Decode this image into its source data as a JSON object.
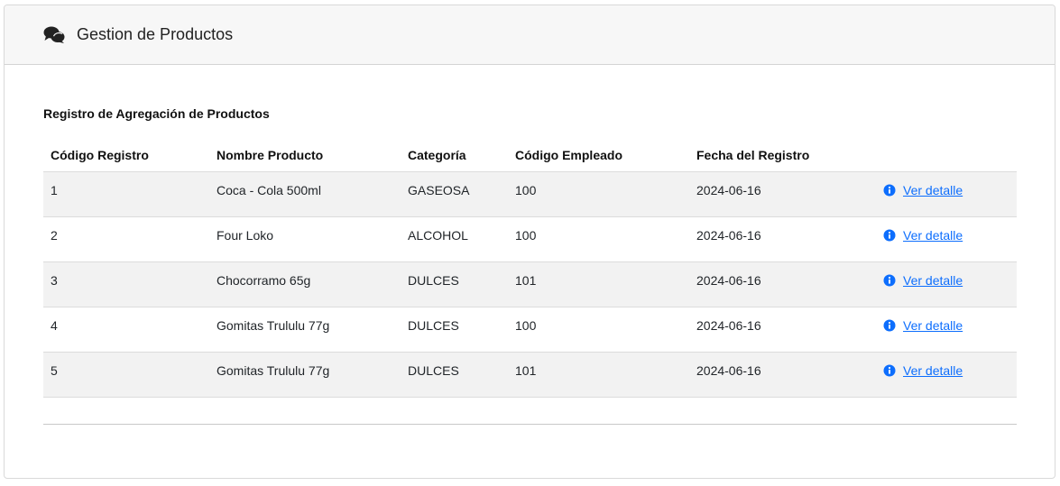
{
  "header": {
    "icon": "comments-icon",
    "title": "Gestion de Productos"
  },
  "section": {
    "subtitle": "Registro de Agregación de Productos"
  },
  "table": {
    "columns": [
      "Código Registro",
      "Nombre Producto",
      "Categoría",
      "Código Empleado",
      "Fecha del Registro",
      ""
    ],
    "rows": [
      {
        "codigo": "1",
        "nombre": "Coca - Cola 500ml",
        "categoria": "GASEOSA",
        "empleado": "100",
        "fecha": "2024-06-16",
        "accion": "Ver detalle"
      },
      {
        "codigo": "2",
        "nombre": "Four Loko",
        "categoria": "ALCOHOL",
        "empleado": "100",
        "fecha": "2024-06-16",
        "accion": "Ver detalle"
      },
      {
        "codigo": "3",
        "nombre": "Chocorramo 65g",
        "categoria": "DULCES",
        "empleado": "101",
        "fecha": "2024-06-16",
        "accion": "Ver detalle"
      },
      {
        "codigo": "4",
        "nombre": "Gomitas Trululu 77g",
        "categoria": "DULCES",
        "empleado": "100",
        "fecha": "2024-06-16",
        "accion": "Ver detalle"
      },
      {
        "codigo": "5",
        "nombre": "Gomitas Trululu 77g",
        "categoria": "DULCES",
        "empleado": "101",
        "fecha": "2024-06-16",
        "accion": "Ver detalle"
      }
    ]
  },
  "colors": {
    "link": "#0d6efd",
    "header_bg": "#f7f7f7",
    "stripe": "#f2f2f2"
  },
  "icons": {
    "row_action": "info-circle-icon"
  }
}
